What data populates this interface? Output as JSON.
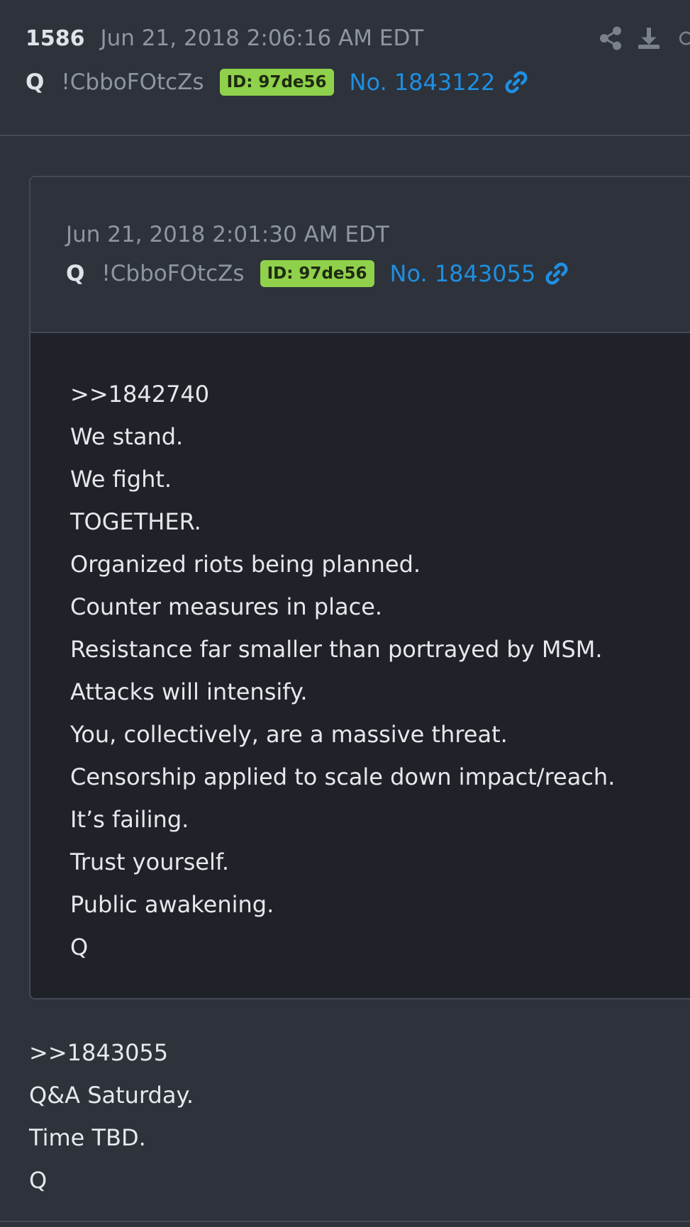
{
  "post": {
    "number": "1586",
    "timestamp": "Jun 21, 2018 2:06:16 AM EDT",
    "author": "Q",
    "tripcode": "!CbboFOtcZs",
    "id_badge": "ID: 97de56",
    "post_no": "No. 1843122"
  },
  "quoted": {
    "timestamp": "Jun 21, 2018 2:01:30 AM EDT",
    "author": "Q",
    "tripcode": "!CbboFOtcZs",
    "id_badge": "ID: 97de56",
    "post_no": "No. 1843055",
    "lines": [
      ">>1842740",
      "We stand.",
      "We fight.",
      "TOGETHER.",
      "Organized riots being planned.",
      "Counter measures in place.",
      "Resistance far smaller than portrayed by MSM.",
      "Attacks will intensify.",
      "You, collectively, are a massive threat.",
      "Censorship applied to scale down impact/reach.",
      "It’s failing.",
      "Trust yourself.",
      "Public awakening.",
      "Q"
    ]
  },
  "body": {
    "lines": [
      ">>1843055",
      "Q&A Saturday.",
      "Time TBD.",
      "Q"
    ]
  },
  "colors": {
    "background": "#2d323b",
    "quote_body": "#1f2229",
    "id_badge": "#8fd14a",
    "link": "#1f8fe0",
    "muted_text": "#8f96a0"
  },
  "icons": [
    "share-icon",
    "download-icon",
    "more-icon",
    "link-icon"
  ]
}
